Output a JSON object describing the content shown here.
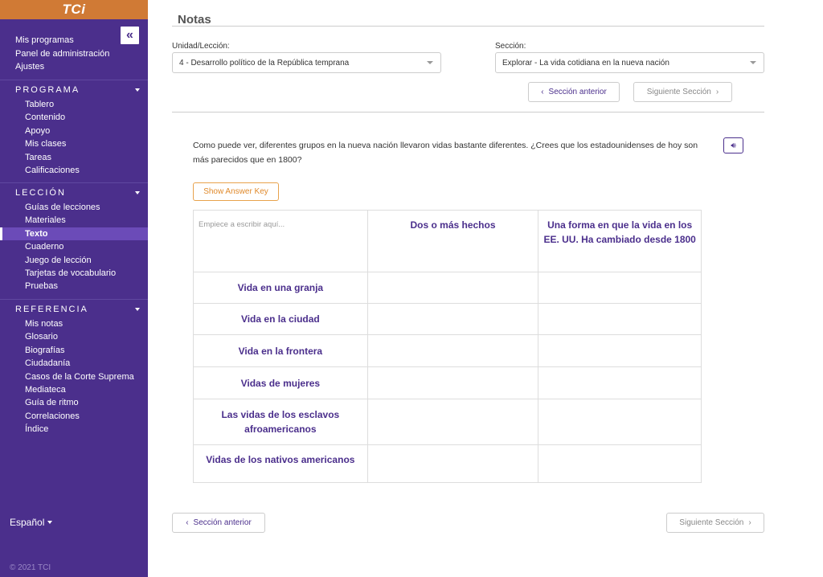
{
  "sidebar": {
    "logo": "TCi",
    "collapse_icon": "«",
    "top_links": [
      "Mis programas",
      "Panel de administración",
      "Ajustes"
    ],
    "sections": [
      {
        "title": "PROGRAMA",
        "items": [
          "Tablero",
          "Contenido",
          "Apoyo",
          "Mis clases",
          "Tareas",
          "Calificaciones"
        ]
      },
      {
        "title": "LECCIÓN",
        "items": [
          "Guías de lecciones",
          "Materiales",
          "Texto",
          "Cuaderno",
          "Juego de lección",
          "Tarjetas de vocabulario",
          "Pruebas"
        ],
        "active": "Texto"
      },
      {
        "title": "REFERENCIA",
        "items": [
          "Mis notas",
          "Glosario",
          "Biografías",
          "Ciudadanía",
          "Casos de la Corte Suprema",
          "Mediateca",
          "Guía de ritmo",
          "Correlaciones",
          "Índice"
        ]
      }
    ],
    "language": "Español",
    "copyright": "© 2021 TCI"
  },
  "main": {
    "title": "Notas",
    "unit_label": "Unidad/Lección:",
    "unit_value": "4 - Desarrollo político de la República temprana",
    "section_label": "Sección:",
    "section_value": "Explorar - La vida cotidiana en la nueva nación",
    "prev_button": "Sección anterior",
    "next_button": "Siguiente Sección",
    "question": "Como puede ver, diferentes grupos en la nueva nación llevaron vidas bastante diferentes. ¿Crees que los estadounidenses de hoy son más parecidos que en 1800?",
    "answer_key_button": "Show Answer Key",
    "table": {
      "placeholder": "Empiece a escribir aquí...",
      "headers": [
        "Dos o más hechos",
        "Una forma en que la vida en los EE. UU. Ha cambiado desde 1800"
      ],
      "rows": [
        "Vida en una granja",
        "Vida en la ciudad",
        "Vida en la frontera",
        "Vidas de mujeres",
        "Las vidas de los esclavos afroamericanos",
        "Vidas de los nativos americanos"
      ]
    }
  },
  "colors": {
    "sidebar_bg": "#4b2f8c",
    "sidebar_top_bg": "#d07a35",
    "active_item_bg": "#6b4bb8",
    "accent_purple": "#4b2f8c",
    "answer_key_orange": "#e08a2c"
  }
}
